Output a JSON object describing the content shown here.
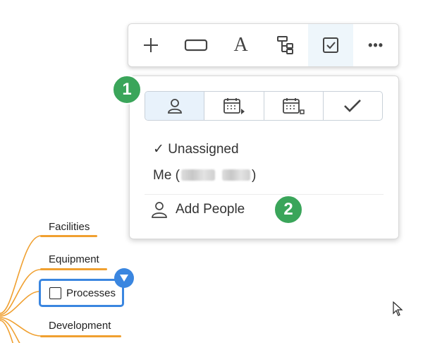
{
  "toolbar": {
    "buttons": [
      {
        "icon": "plus-icon"
      },
      {
        "icon": "rectangle-shape-icon"
      },
      {
        "icon": "text-icon",
        "glyph": "A"
      },
      {
        "icon": "hierarchy-icon"
      },
      {
        "icon": "task-checkbox-icon",
        "active": true
      },
      {
        "icon": "more-options-icon",
        "glyph": "•••"
      }
    ]
  },
  "panel": {
    "tabs": [
      {
        "icon": "person-icon",
        "active": true
      },
      {
        "icon": "calendar-start-icon"
      },
      {
        "icon": "calendar-end-icon"
      },
      {
        "icon": "checkmark-icon"
      }
    ],
    "options": {
      "unassigned": "✓ Unassigned",
      "me_prefix": "Me (",
      "me_suffix": ")"
    },
    "add_people": "Add People"
  },
  "badges": {
    "one": "1",
    "two": "2"
  },
  "mindmap": {
    "nodes": [
      "Facilities",
      "Equipment",
      "Processes",
      "Development"
    ],
    "line_color": "#f0a030",
    "selected_color": "#3a86e0"
  }
}
